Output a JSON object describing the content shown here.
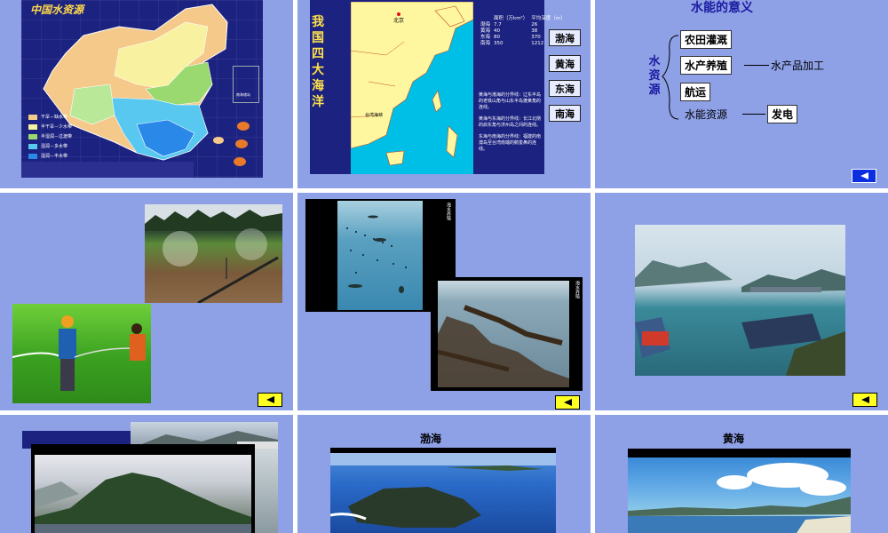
{
  "slide1": {
    "map_title": "中国水资源",
    "legend": [
      {
        "label": "干旱－缺水带",
        "color": "#f4c98a"
      },
      {
        "label": "半干旱－少水带",
        "color": "#f7f1a0"
      },
      {
        "label": "半湿润－过渡带",
        "color": "#9ad870"
      },
      {
        "label": "湿润－多水带",
        "color": "#58c8f0"
      },
      {
        "label": "湿润－丰水带",
        "color": "#2a88e8"
      }
    ],
    "inset_label": "南海诸岛"
  },
  "slide2": {
    "vertical_title": [
      "我",
      "国",
      "四",
      "大",
      "海",
      "洋"
    ],
    "map_label_beijing": "北京",
    "map_label_strait": "台湾海峡",
    "table_headers": [
      "面积（万km²）",
      "平均深度（m）"
    ],
    "table_rows": [
      {
        "name": "渤海",
        "area": "7.7",
        "depth": "26"
      },
      {
        "name": "黄海",
        "area": "40",
        "depth": "38"
      },
      {
        "name": "东海",
        "area": "80",
        "depth": "370"
      },
      {
        "name": "南海",
        "area": "350",
        "depth": "1212"
      }
    ],
    "notes": [
      "黄海与渤海的分界线：辽东半岛的老铁山角与山东半岛蓬莱角的连线。",
      "黄海与东海的分界线：长江北侧的启东角与济州岛之间的连线。",
      "东海与南海的分界线：福建的南澳岛至台湾南端的鹅銮鼻的连线。"
    ],
    "buttons": [
      "渤海",
      "黄海",
      "东海",
      "南海"
    ]
  },
  "slide3": {
    "title": "水能的意义",
    "root": [
      "水",
      "资",
      "源"
    ],
    "box_irrigation": "农田灌溉",
    "box_aquaculture": "水产养殖",
    "text_processing": "水产品加工",
    "box_shipping": "航运",
    "text_hydropower": "水能资源",
    "box_power": "发电"
  },
  "slide5": {
    "caption_1": "海水养殖",
    "caption_2": "海水养殖"
  },
  "slide8": {
    "heading": "渤海"
  },
  "slide9": {
    "heading": "黄海"
  },
  "colors": {
    "slide_bg": "#8ea0e6",
    "panel_dark": "#1c2280",
    "nav_yellow": "#ffff22",
    "nav_blue": "#0a2ee0"
  }
}
